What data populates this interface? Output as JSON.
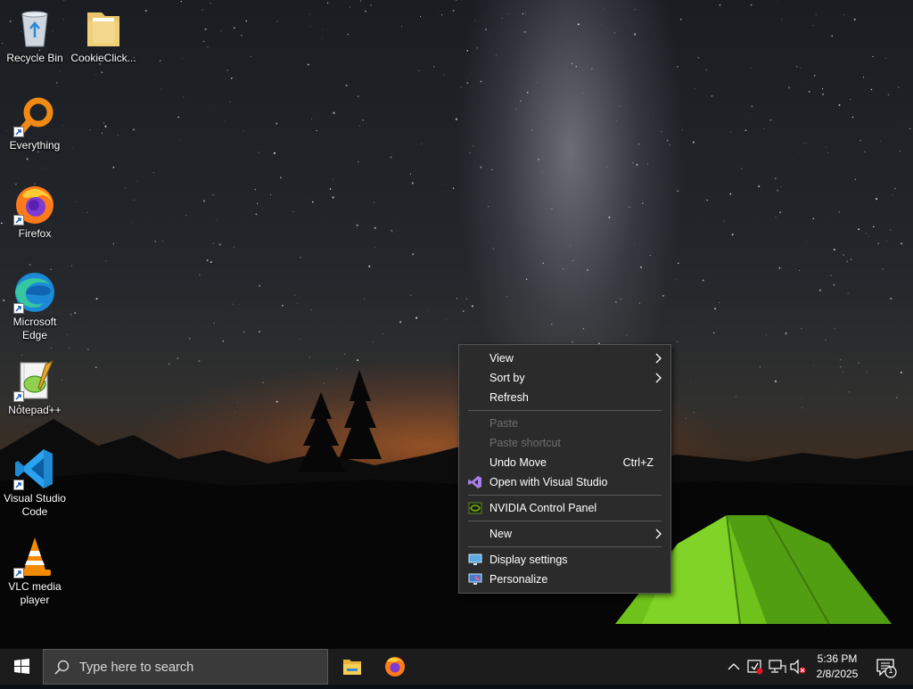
{
  "desktop": {
    "icons": [
      {
        "label": "Recycle Bin",
        "icon": "recycle-bin-icon"
      },
      {
        "label": "CookieClick...",
        "icon": "folder-icon"
      },
      {
        "label": "Everything",
        "icon": "everything-search-icon"
      },
      {
        "label": "Firefox",
        "icon": "firefox-icon"
      },
      {
        "label": "Microsoft Edge",
        "icon": "edge-icon"
      },
      {
        "label": "Notepad++",
        "icon": "notepadpp-icon"
      },
      {
        "label": "Visual Studio Code",
        "icon": "vscode-icon"
      },
      {
        "label": "VLC media player",
        "icon": "vlc-icon"
      }
    ]
  },
  "context_menu": {
    "items": [
      {
        "label": "View",
        "submenu": true
      },
      {
        "label": "Sort by",
        "submenu": true
      },
      {
        "label": "Refresh"
      },
      {
        "label": "Paste",
        "disabled": true
      },
      {
        "label": "Paste shortcut",
        "disabled": true
      },
      {
        "label": "Undo Move",
        "shortcut": "Ctrl+Z"
      },
      {
        "label": "Open with Visual Studio",
        "icon": "visual-studio-icon"
      },
      {
        "label": "NVIDIA Control Panel",
        "icon": "nvidia-icon"
      },
      {
        "label": "New",
        "submenu": true
      },
      {
        "label": "Display settings",
        "icon": "display-icon"
      },
      {
        "label": "Personalize",
        "icon": "personalize-icon"
      }
    ]
  },
  "taskbar": {
    "search_placeholder": "Type here to search",
    "pinned": [
      "file-explorer-icon",
      "firefox-icon"
    ],
    "tray": [
      "chevron-up-icon",
      "security-icon",
      "network-icon",
      "volume-muted-icon"
    ],
    "time": "5:36 PM",
    "date": "2/8/2025",
    "notification_count": "1"
  },
  "colors": {
    "menu_bg": "#2b2b2b",
    "taskbar_bg": "#1c1c1c",
    "search_bg": "#3a3a3a"
  }
}
